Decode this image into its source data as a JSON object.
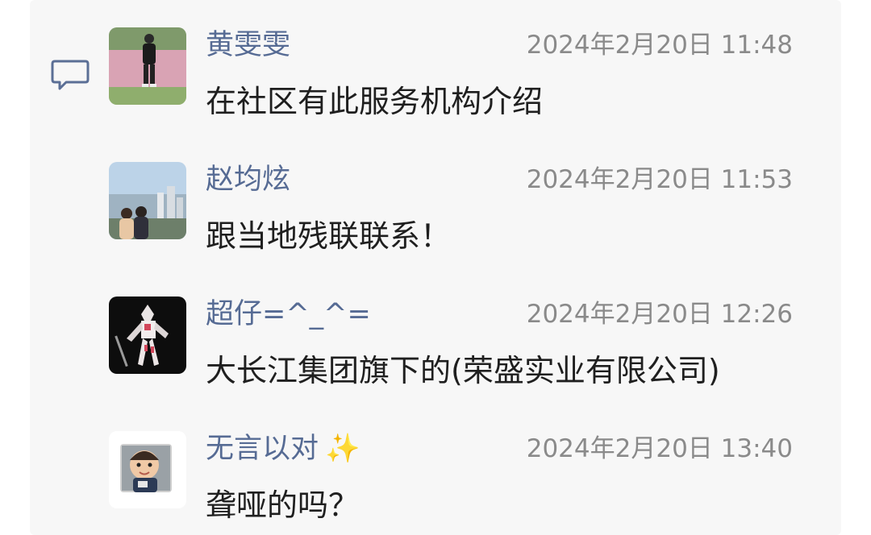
{
  "comments": [
    {
      "name": "黄雯雯",
      "time": "2024年2月20日 11:48",
      "text": "在社区有此服务机构介绍",
      "avatar_icon": "person-standing-in-pink-grass-avatar"
    },
    {
      "name": "赵均炫",
      "time": "2024年2月20日 11:53",
      "text": "跟当地残联联系！",
      "avatar_icon": "couple-city-view-avatar"
    },
    {
      "name": "超仔=^_^=",
      "time": "2024年2月20日 12:26",
      "text": "大长江集团旗下的(荣盛实业有限公司)",
      "avatar_icon": "robot-figure-avatar"
    },
    {
      "name": "无言以对",
      "name_emoji": "✨",
      "time": "2024年2月20日 13:40",
      "text": "聋哑的吗？",
      "avatar_icon": "baby-photo-avatar"
    }
  ],
  "colors": {
    "panel_bg": "#f7f7f7",
    "name": "#566b94",
    "time": "#8a8a8a",
    "text": "#1f1f1f"
  }
}
